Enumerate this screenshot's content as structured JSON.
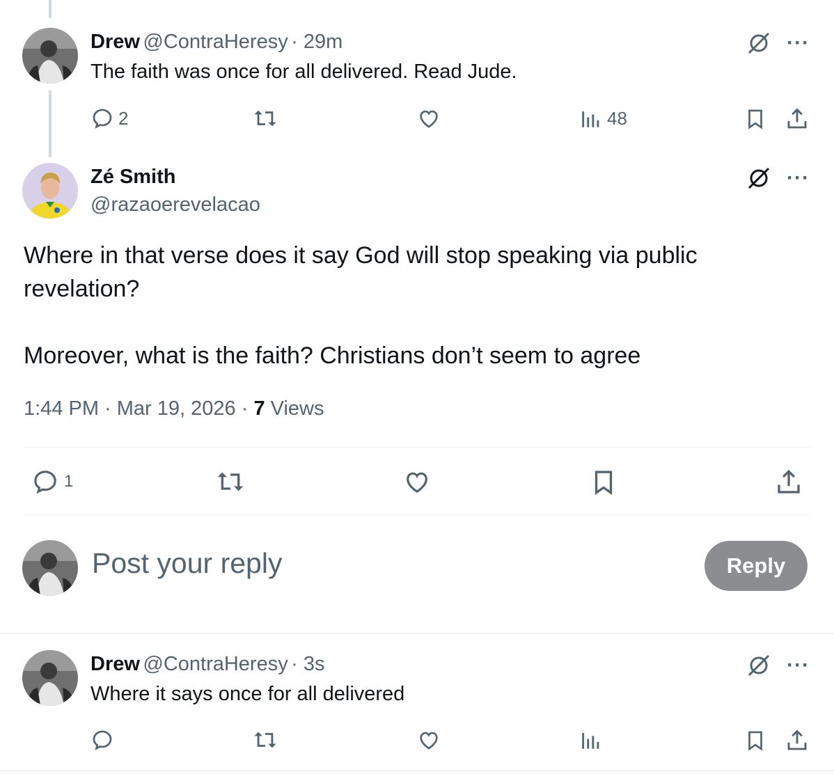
{
  "thread": [
    {
      "display_name": "Drew",
      "handle": "@ContraHeresy",
      "time": "· 29m",
      "text": "The faith was once for all delivered. Read Jude.",
      "replies": "2",
      "views": "48"
    }
  ],
  "main_post": {
    "display_name": "Zé Smith",
    "handle": "@razaoerevelacao",
    "text_line1": "Where in that verse does it say God will stop speaking via public",
    "text_line2": "revelation?",
    "text_line3": "Moreover, what is the faith? Christians don’t seem to agree",
    "timestamp": "1:44 PM · Mar 19, 2026 · ",
    "views_count": "7",
    "views_label": " Views",
    "replies": "1"
  },
  "composer": {
    "placeholder": "Post your reply",
    "reply_button": "Reply"
  },
  "reply": {
    "display_name": "Drew",
    "handle": "@ContraHeresy",
    "time": "· 3s",
    "text": "Where it says once for all delivered"
  },
  "icons": {
    "more": "···"
  },
  "colors": {
    "text": "#0f1419",
    "muted": "#536471",
    "divider": "#eff3f4",
    "reply_button": "#8b8d90"
  }
}
